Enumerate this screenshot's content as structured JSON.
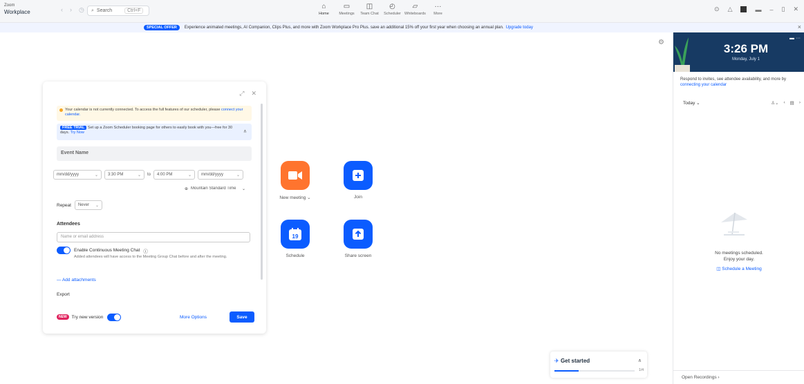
{
  "app": {
    "brand_line1": "Zoom",
    "brand_line2": "Workplace",
    "search_placeholder": "Search",
    "search_shortcut": "Ctrl+F"
  },
  "nav": {
    "tabs": [
      {
        "label": "Home",
        "icon": "home-icon"
      },
      {
        "label": "Meetings",
        "icon": "meetings-icon"
      },
      {
        "label": "Team Chat",
        "icon": "chat-icon"
      },
      {
        "label": "Scheduler",
        "icon": "scheduler-icon"
      },
      {
        "label": "Whiteboards",
        "icon": "whiteboard-icon"
      },
      {
        "label": "More",
        "icon": "more-icon"
      }
    ]
  },
  "promo": {
    "badge": "SPECIAL OFFER",
    "text": "Experience animated meetings, AI Companion, Clips Plus, and more with Zoom Workplace Pro Plus. save an additional 15% off your first year when choosing an annual plan.",
    "link": "Upgrade today"
  },
  "schedule": {
    "calendar_alert": "Your calendar is not currently connected. To access the full features of our scheduler, please",
    "calendar_alert_link": "connect your calendar.",
    "trial_badge": "FREE TRIAL",
    "trial_text": "Set up a Zoom Scheduler booking page for others to easily book with you—free for 30 days.",
    "trial_link": "Try Now",
    "event_name_placeholder": "Event Name",
    "start_date": "mm/dd/yyyy",
    "start_time": "3:30 PM",
    "to_label": "to",
    "end_time": "4:00 PM",
    "end_date": "mm/dd/yyyy",
    "timezone": "Mountain Standard Time",
    "repeat_label": "Repeat",
    "repeat_value": "Never",
    "attendees_label": "Attendees",
    "attendees_placeholder": "Name or email address",
    "continuous_chat_label": "Enable Continuous Meeting Chat",
    "continuous_chat_desc": "Added attendees will have access to the Meeting Group Chat before and after the meeting.",
    "add_attachments": "Add attachments",
    "export_label": "Export",
    "new_pill": "NEW",
    "try_new_label": "Try new version",
    "more_options": "More Options",
    "save": "Save"
  },
  "tiles": [
    {
      "label": "New meeting",
      "color": "#ff742e",
      "icon": "video-camera-icon"
    },
    {
      "label": "Join",
      "color": "#0b5cff",
      "icon": "plus-icon"
    },
    {
      "label": "Schedule",
      "color": "#0b5cff",
      "icon": "calendar-icon",
      "day": "19"
    },
    {
      "label": "Share screen",
      "color": "#0b5cff",
      "icon": "share-arrow-icon"
    }
  ],
  "get_started": {
    "title": "Get started",
    "progress": 0.3,
    "progress_label": "1/4"
  },
  "right_panel": {
    "time": "3:26 PM",
    "date": "Monday, July 1",
    "calendar_prompt": "Respond to invites, see attendee availability, and more by",
    "calendar_prompt_link": "connecting your calendar",
    "today": "Today",
    "no_meetings_line1": "No meetings scheduled.",
    "no_meetings_line2": "Enjoy your day.",
    "schedule_link": "Schedule a Meeting",
    "open_recordings": "Open Recordings"
  }
}
